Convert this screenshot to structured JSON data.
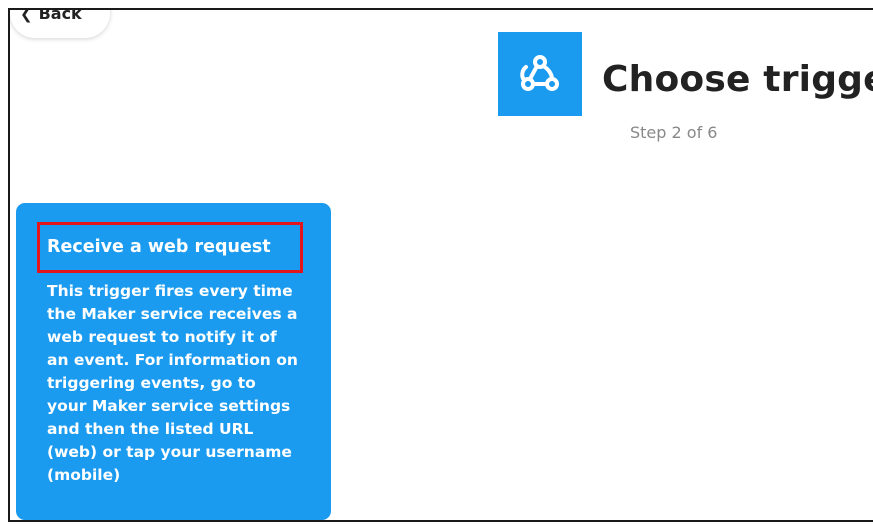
{
  "nav": {
    "back_label": "Back"
  },
  "header": {
    "title": "Choose trigger",
    "step": "Step 2 of 6",
    "service_icon": "webhooks-icon",
    "service_color": "#1b9bf0"
  },
  "trigger": {
    "title": "Receive a web request",
    "description": "This trigger fires every time\nthe Maker service receives a\nweb request to notify it of\nan event. For information on\ntriggering events, go to\nyour Maker service settings\nand then the listed URL\n(web) or tap your username\n(mobile)",
    "highlight_color": "#e3151d"
  }
}
